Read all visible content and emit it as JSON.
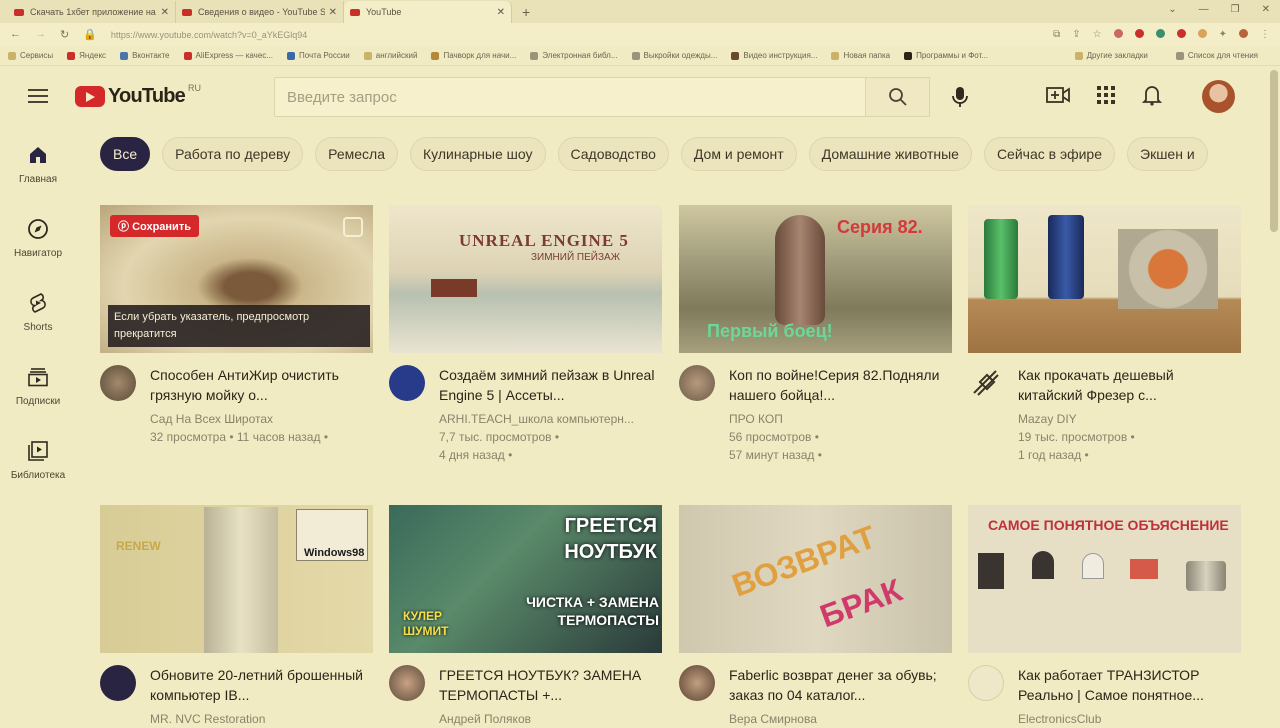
{
  "browser": {
    "tabs": [
      {
        "title": "Скачать 1xбет приложение на"
      },
      {
        "title": "Сведения о видео - YouTube St"
      },
      {
        "title": "YouTube"
      }
    ],
    "url": "https://www.youtube.com/watch?v=0_aYkEGlq94",
    "bookmarks": [
      "Сервисы",
      "Яндекс",
      "Вконтакте",
      "AliExpress — качес...",
      "Почта России",
      "английский",
      "Пачворк для начи...",
      "Электронная библ...",
      "Выкройки одежды...",
      "Видео инструкция...",
      "Новая папка",
      "Программы и Фот..."
    ],
    "bookmarks_right": [
      "Другие закладки",
      "Список для чтения"
    ]
  },
  "header": {
    "logo_text": "YouTube",
    "region": "RU",
    "search_placeholder": "Введите запрос"
  },
  "sidebar": [
    {
      "label": "Главная",
      "icon": "home-icon"
    },
    {
      "label": "Навигатор",
      "icon": "compass-icon"
    },
    {
      "label": "Shorts",
      "icon": "shorts-icon"
    },
    {
      "label": "Подписки",
      "icon": "subscriptions-icon"
    },
    {
      "label": "Библиотека",
      "icon": "library-icon"
    }
  ],
  "chips": [
    "Все",
    "Работа по дереву",
    "Ремесла",
    "Кулинарные шоу",
    "Садоводство",
    "Дом и ремонт",
    "Домашние животные",
    "Сейчас в эфире",
    "Экшен и"
  ],
  "videos": [
    {
      "title": "Способен АнтиЖир очистить грязную мойку о...",
      "channel": "Сад  На  Всех Широтах",
      "views": "32 просмотра • 11 часов назад •",
      "age": "",
      "save_label": "Сохранить",
      "preview_tip": "Если убрать указатель, предпросмотр прекратится"
    },
    {
      "title": "Создаём зимний пейзаж в Unreal Engine 5 | Ассеты...",
      "channel": "ARHI.TEACH_школа компьютерн...",
      "views": "7,7 тыс. просмотров •",
      "age": "4 дня назад •",
      "thumb_text": "UNREAL ENGINE 5",
      "thumb_sub": "ЗИМНИЙ ПЕЙЗАЖ"
    },
    {
      "title": "Коп по войне!Серия 82.Подняли нашего бойца!...",
      "channel": "ПРО КОП",
      "views": "56 просмотров •",
      "age": "57 минут назад •",
      "thumb_text": "Серия 82.",
      "thumb_sub": "Первый боец!"
    },
    {
      "title": "Как прокачать дешевый китайский Фрезер с...",
      "channel": "Mazay DIY",
      "views": "19 тыс. просмотров •",
      "age": "1 год назад •"
    },
    {
      "title": "Обновите 20-летний брошенный компьютер IB...",
      "channel": "MR. NVC Restoration",
      "thumb_text": "RENEW",
      "thumb_sub": "Windows98"
    },
    {
      "title": "ГРЕЕТСЯ НОУТБУК? ЗАМЕНА ТЕРМОПАСТЫ +...",
      "channel": "Андрей Поляков",
      "thumb_text": "ГРЕЕТСЯ НОУТБУК",
      "thumb_sub": "ЧИСТКА + ЗАМЕНА ТЕРМОПАСТЫ",
      "thumb_extra": "КУЛЕР ШУМИТ"
    },
    {
      "title": "Faberlic возврат денег за обувь; заказ по 04 каталог...",
      "channel": "Вера Смирнова",
      "thumb_text": "ВОЗВРАТ",
      "thumb_sub": "БРАК"
    },
    {
      "title": "Как работает ТРАНЗИСТОР Реально | Самое понятное...",
      "channel": "ElectronicsClub",
      "thumb_text": "САМОЕ ПОНЯТНОЕ ОБЪЯСНЕНИЕ"
    }
  ]
}
